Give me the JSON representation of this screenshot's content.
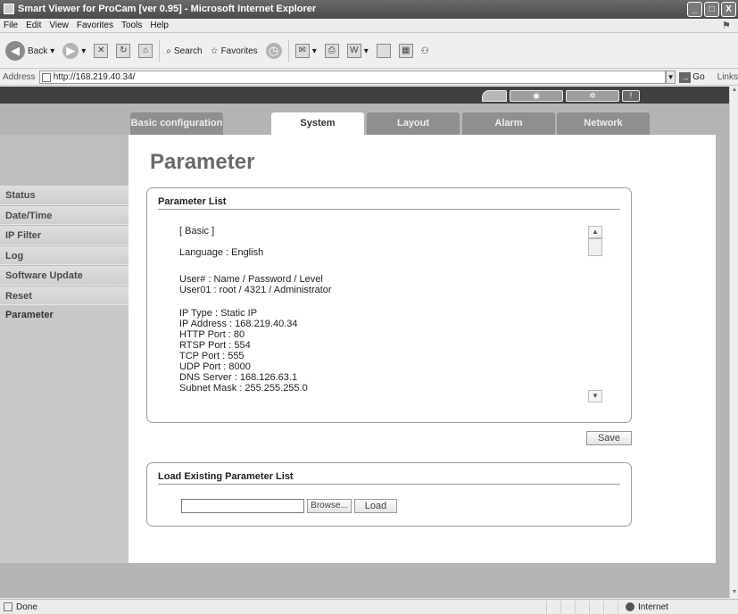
{
  "window": {
    "title": "Smart Viewer for ProCam [ver 0.95] - Microsoft Internet Explorer",
    "min": "_",
    "max": "□",
    "close": "X"
  },
  "menu": [
    "File",
    "Edit",
    "View",
    "Favorites",
    "Tools",
    "Help"
  ],
  "toolbar": {
    "back": "Back",
    "search": "Search",
    "favorites": "Favorites"
  },
  "address": {
    "label": "Address",
    "url": "http://168.219.40.34/",
    "go": "Go",
    "links": "Links"
  },
  "tabs": [
    {
      "label": "Basic configuration"
    },
    {
      "label": "System"
    },
    {
      "label": "Layout"
    },
    {
      "label": "Alarm"
    },
    {
      "label": "Network"
    }
  ],
  "active_tab": "System",
  "sidebar": {
    "items": [
      {
        "label": "Status"
      },
      {
        "label": "Date/Time"
      },
      {
        "label": "IP Filter"
      },
      {
        "label": "Log"
      },
      {
        "label": "Software Update"
      },
      {
        "label": "Reset"
      },
      {
        "label": "Parameter"
      }
    ]
  },
  "page": {
    "title": "Parameter",
    "param_list": {
      "title": "Parameter List",
      "lines": [
        "[ Basic ]",
        "",
        "Language : English",
        "",
        "User# : Name / Password / Level",
        "User01 : root / 4321 / Administrator",
        "",
        "IP Type : Static IP",
        "IP Address : 168.219.40.34",
        "HTTP Port : 80",
        "RTSP Port : 554",
        "TCP Port : 555",
        "UDP Port : 8000",
        "DNS Server : 168.126.63.1",
        "Subnet Mask : 255.255.255.0"
      ]
    },
    "save_label": "Save",
    "load": {
      "title": "Load Existing Parameter List",
      "browse_label": "Browse...",
      "load_label": "Load",
      "file_value": ""
    }
  },
  "statusbar": {
    "left": "Done",
    "zone": "Internet"
  }
}
